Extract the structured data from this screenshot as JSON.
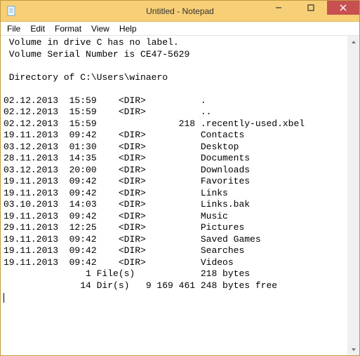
{
  "window": {
    "title": "Untitled - Notepad"
  },
  "menu": {
    "file": "File",
    "edit": "Edit",
    "format": "Format",
    "view": "View",
    "help": "Help"
  },
  "text": {
    "line1": " Volume in drive C has no label.",
    "line2": " Volume Serial Number is CE47-5629",
    "blank": "",
    "line3": " Directory of C:\\Users\\winaero",
    "rows": [
      {
        "date": "02.12.2013",
        "time": "15:59",
        "type": "<DIR>",
        "size": "",
        "name": "."
      },
      {
        "date": "02.12.2013",
        "time": "15:59",
        "type": "<DIR>",
        "size": "",
        "name": ".."
      },
      {
        "date": "02.12.2013",
        "time": "15:59",
        "type": "",
        "size": "218",
        "name": ".recently-used.xbel"
      },
      {
        "date": "19.11.2013",
        "time": "09:42",
        "type": "<DIR>",
        "size": "",
        "name": "Contacts"
      },
      {
        "date": "03.12.2013",
        "time": "01:30",
        "type": "<DIR>",
        "size": "",
        "name": "Desktop"
      },
      {
        "date": "28.11.2013",
        "time": "14:35",
        "type": "<DIR>",
        "size": "",
        "name": "Documents"
      },
      {
        "date": "03.12.2013",
        "time": "20:00",
        "type": "<DIR>",
        "size": "",
        "name": "Downloads"
      },
      {
        "date": "19.11.2013",
        "time": "09:42",
        "type": "<DIR>",
        "size": "",
        "name": "Favorites"
      },
      {
        "date": "19.11.2013",
        "time": "09:42",
        "type": "<DIR>",
        "size": "",
        "name": "Links"
      },
      {
        "date": "03.10.2013",
        "time": "14:03",
        "type": "<DIR>",
        "size": "",
        "name": "Links.bak"
      },
      {
        "date": "19.11.2013",
        "time": "09:42",
        "type": "<DIR>",
        "size": "",
        "name": "Music"
      },
      {
        "date": "29.11.2013",
        "time": "12:25",
        "type": "<DIR>",
        "size": "",
        "name": "Pictures"
      },
      {
        "date": "19.11.2013",
        "time": "09:42",
        "type": "<DIR>",
        "size": "",
        "name": "Saved Games"
      },
      {
        "date": "19.11.2013",
        "time": "09:42",
        "type": "<DIR>",
        "size": "",
        "name": "Searches"
      },
      {
        "date": "19.11.2013",
        "time": "09:42",
        "type": "<DIR>",
        "size": "",
        "name": "Videos"
      }
    ],
    "summary1": "               1 File(s)            218 bytes",
    "summary2": "              14 Dir(s)   9 169 461 248 bytes free"
  }
}
